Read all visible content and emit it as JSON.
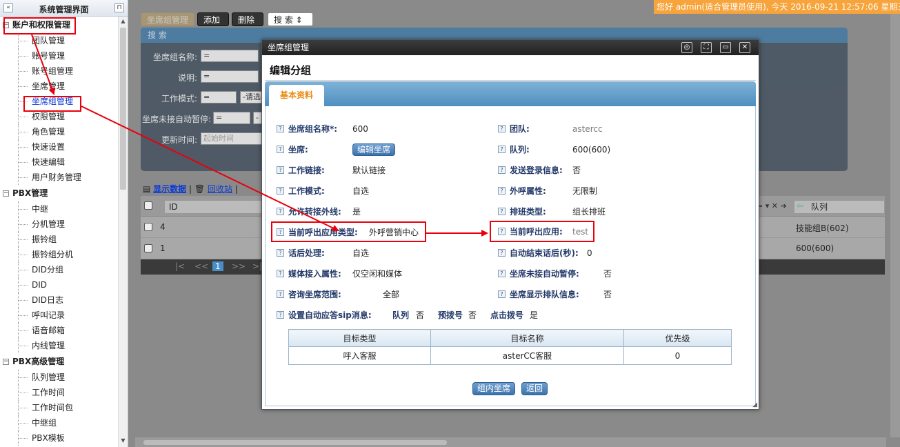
{
  "sidebar": {
    "title": "系统管理界面",
    "sections": [
      {
        "label": "账户和权限管理",
        "items": [
          "团队管理",
          "账号管理",
          "账号组管理",
          "坐席管理",
          "坐席组管理",
          "权限管理",
          "角色管理",
          "快速设置",
          "快速编辑",
          "用户财务管理"
        ]
      },
      {
        "label": "PBX管理",
        "items": [
          "中继",
          "分机管理",
          "振铃组",
          "振铃组分机",
          "DID分组",
          "DID",
          "DID日志",
          "呼叫记录",
          "语音邮箱",
          "内线管理"
        ]
      },
      {
        "label": "PBX高级管理",
        "items": [
          "队列管理",
          "工作时间",
          "工作时间包",
          "中继组",
          "PBX模板"
        ]
      }
    ]
  },
  "banner": "您好 admin(适合管理员使用), 今天 2016-09-21 12:57:06 星期三",
  "toolbar": {
    "tab": "坐席组管理",
    "add": "添加",
    "delete": "删除",
    "search": "搜 索"
  },
  "search_panel": {
    "title": "搜 索",
    "fields": [
      {
        "label": "坐席组名称:",
        "op": "="
      },
      {
        "label": "说明:",
        "op": "="
      },
      {
        "label": "工作模式:",
        "op": "=",
        "value": "-请选"
      },
      {
        "label": "坐席未接自动暂停:",
        "op": "=",
        "value": "-"
      },
      {
        "label": "更新时间:",
        "placeholder": "起始时间"
      }
    ]
  },
  "data_links": {
    "show": "显示数据",
    "recycle": "回收站"
  },
  "grid": {
    "col_id": "ID",
    "col_queue": "队列",
    "rows": [
      {
        "id": "4",
        "queue": "技能组B(602)"
      },
      {
        "id": "1",
        "queue": "600(600)"
      }
    ],
    "pager": {
      "first": "|<",
      "prev": "<<",
      "page": "1",
      "next": ">>",
      "last": ">|"
    }
  },
  "dialog": {
    "title": "坐席组管理",
    "heading": "编辑分组",
    "tab": "基本资料",
    "left_fields": [
      {
        "label": "坐席组名称*:",
        "value": "600"
      },
      {
        "label": "坐席:",
        "button": "编辑坐席"
      },
      {
        "label": "工作链接:",
        "value": "默认链接"
      },
      {
        "label": "工作模式:",
        "value": "自选"
      },
      {
        "label": "允许转接外线:",
        "value": "是"
      },
      {
        "label": "当前呼出应用类型:",
        "value": "外呼营销中心"
      },
      {
        "label": "话后处理:",
        "value": "自选"
      },
      {
        "label": "媒体接入属性:",
        "value": "仅空闲和媒体"
      },
      {
        "label": "咨询坐席范围:",
        "value": "全部"
      },
      {
        "label": "设置自动应答sip消息:",
        "value": ""
      }
    ],
    "right_fields": [
      {
        "label": "团队:",
        "value": "astercc"
      },
      {
        "label": "队列:",
        "value": "600(600)"
      },
      {
        "label": "发送登录信息:",
        "value": "否"
      },
      {
        "label": "外呼属性:",
        "value": "无限制"
      },
      {
        "label": "排班类型:",
        "value": "组长排班"
      },
      {
        "label": "当前呼出应用:",
        "value": "test"
      },
      {
        "label": "自动结束话后(秒):",
        "value": "0"
      },
      {
        "label": "坐席未接自动暂停:",
        "value": "否"
      },
      {
        "label": "坐席显示排队信息:",
        "value": "否"
      }
    ],
    "sip_options": {
      "queue_label": "队列",
      "queue_val": "否",
      "predial_label": "预拨号",
      "predial_val": "否",
      "click_label": "点击拨号",
      "click_val": "是"
    },
    "table": {
      "headers": [
        "目标类型",
        "目标名称",
        "优先级"
      ],
      "rows": [
        [
          "呼入客服",
          "asterCC客服",
          "0"
        ]
      ]
    },
    "buttons": {
      "members": "组内坐席",
      "back": "返回"
    }
  },
  "colors": {
    "highlight": "#e8000c",
    "banner": "#f7a43c",
    "tab_text": "#e88b10"
  }
}
